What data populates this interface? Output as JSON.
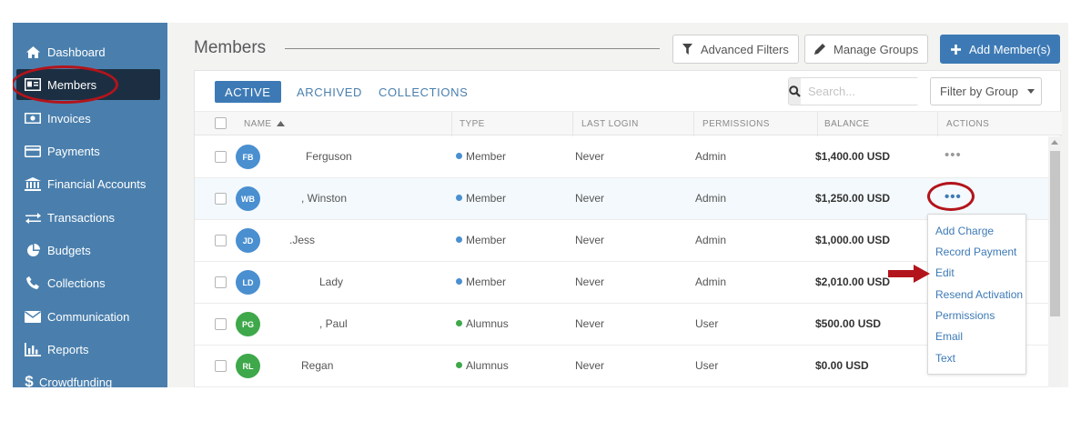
{
  "sidebar": {
    "items": [
      {
        "label": "Dashboard",
        "icon": "home-icon"
      },
      {
        "label": "Members",
        "icon": "id-card-icon",
        "active": true
      },
      {
        "label": "Invoices",
        "icon": "money-icon"
      },
      {
        "label": "Payments",
        "icon": "credit-card-icon"
      },
      {
        "label": "Financial Accounts",
        "icon": "bank-icon"
      },
      {
        "label": "Transactions",
        "icon": "exchange-icon"
      },
      {
        "label": "Budgets",
        "icon": "pie-chart-icon"
      },
      {
        "label": "Collections",
        "icon": "phone-icon"
      },
      {
        "label": "Communication",
        "icon": "envelope-icon"
      },
      {
        "label": "Reports",
        "icon": "bar-chart-icon"
      },
      {
        "label": "Crowdfunding",
        "icon": "dollar-icon"
      }
    ]
  },
  "header": {
    "title": "Members",
    "advanced_filters_label": "Advanced Filters",
    "manage_groups_label": "Manage Groups",
    "add_member_label": "Add Member(s)"
  },
  "tabs": [
    {
      "label": "ACTIVE",
      "active": true
    },
    {
      "label": "ARCHIVED"
    },
    {
      "label": "COLLECTIONS"
    }
  ],
  "search": {
    "placeholder": "Search..."
  },
  "filter_group": {
    "label": "Filter by Group"
  },
  "table": {
    "columns": [
      "NAME",
      "TYPE",
      "LAST LOGIN",
      "PERMISSIONS",
      "BALANCE",
      "ACTIONS"
    ],
    "rows": [
      {
        "initials": "FB",
        "name": "Ferguson",
        "type": "Member",
        "last_login": "Never",
        "permissions": "Admin",
        "balance": "$1,400.00 USD"
      },
      {
        "initials": "WB",
        "name": ", Winston",
        "type": "Member",
        "last_login": "Never",
        "permissions": "Admin",
        "balance": "$1,250.00 USD"
      },
      {
        "initials": "JD",
        "name": ".Jess",
        "type": "Member",
        "last_login": "Never",
        "permissions": "Admin",
        "balance": "$1,000.00 USD"
      },
      {
        "initials": "LD",
        "name": "Lady",
        "type": "Member",
        "last_login": "Never",
        "permissions": "Admin",
        "balance": "$2,010.00 USD"
      },
      {
        "initials": "PG",
        "name": ", Paul",
        "type": "Alumnus",
        "last_login": "Never",
        "permissions": "User",
        "balance": "$500.00 USD"
      },
      {
        "initials": "RL",
        "name": "Regan",
        "type": "Alumnus",
        "last_login": "Never",
        "permissions": "User",
        "balance": "$0.00 USD"
      }
    ]
  },
  "actions_menu": {
    "items": [
      "Add Charge",
      "Record Payment",
      "Edit",
      "Resend Activation",
      "Permissions",
      "Email",
      "Text"
    ]
  },
  "colors": {
    "sidebar": "#4a7fad",
    "sidebar_active": "#1c2f42",
    "accent": "#3d7ab5",
    "member_avatar": "#4a8fd0",
    "alumnus_avatar": "#3ea84a",
    "annotation": "#b3141b"
  }
}
